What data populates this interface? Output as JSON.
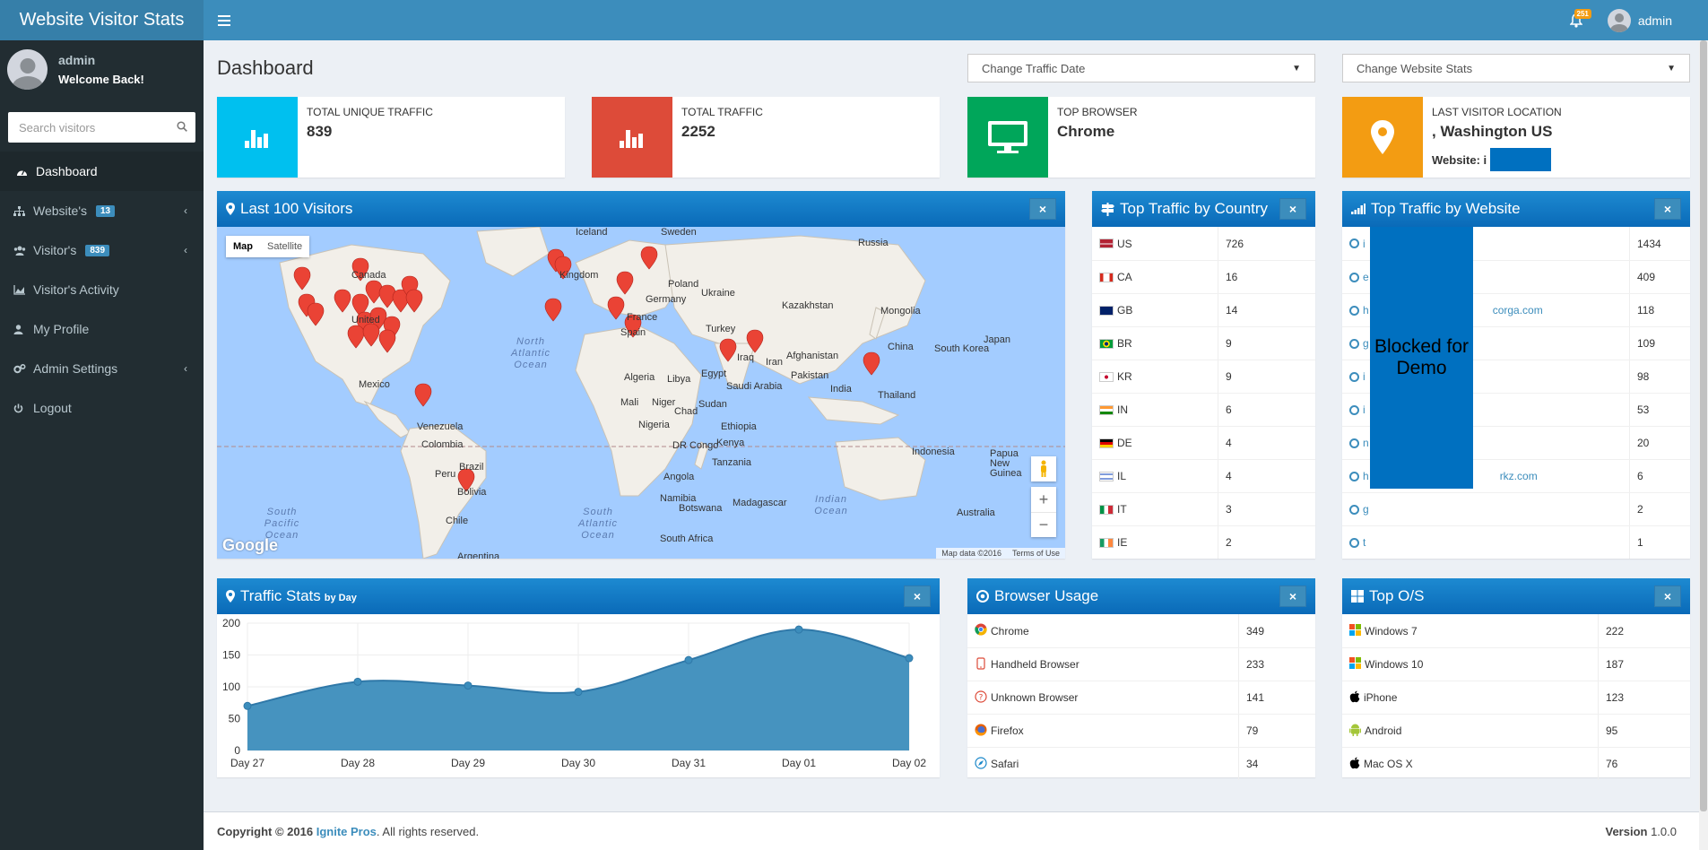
{
  "app": {
    "title": "Website Visitor Stats"
  },
  "topbar": {
    "notification_count": "251",
    "username": "admin"
  },
  "sidebar": {
    "user_name": "admin",
    "welcome": "Welcome Back!",
    "search_placeholder": "Search visitors",
    "items": [
      {
        "label": "Dashboard",
        "icon": "dashboard-icon",
        "active": true
      },
      {
        "label": "Website's",
        "icon": "sitemap-icon",
        "badge": "13"
      },
      {
        "label": "Visitor's",
        "icon": "users-icon",
        "badge": "839"
      },
      {
        "label": "Visitor's Activity",
        "icon": "area-chart-icon"
      },
      {
        "label": "My Profile",
        "icon": "user-icon"
      },
      {
        "label": "Admin Settings",
        "icon": "gears-icon"
      },
      {
        "label": "Logout",
        "icon": "power-icon"
      }
    ]
  },
  "page": {
    "title": "Dashboard",
    "traffic_date_select": "Change Traffic Date",
    "website_stats_select": "Change Website Stats"
  },
  "info_boxes": [
    {
      "label": "TOTAL UNIQUE TRAFFIC",
      "value": "839",
      "color": "#00c0ef",
      "icon": "bar-chart-icon"
    },
    {
      "label": "TOTAL TRAFFIC",
      "value": "2252",
      "color": "#dd4b39",
      "icon": "bar-chart-icon"
    },
    {
      "label": "TOP BROWSER",
      "value": "Chrome",
      "color": "#00a65a",
      "icon": "monitor-icon"
    },
    {
      "label": "LAST VISITOR LOCATION",
      "value": ", Washington US",
      "sub_label": "Website: i",
      "color": "#f39c12",
      "icon": "map-marker-icon"
    }
  ],
  "map_panel": {
    "title": "Last 100 Visitors",
    "btn_map": "Map",
    "btn_satellite": "Satellite",
    "map_data": "Map data ©2016",
    "terms": "Terms of Use",
    "google": "Google",
    "labels": [
      "Iceland",
      "Sweden",
      "Russia",
      "Canada",
      "United",
      "Kingdom",
      "Poland",
      "Ukraine",
      "Germany",
      "France",
      "Kazakhstan",
      "Mongolia",
      "Turkey",
      "Spain",
      "Iraq",
      "Iran",
      "Afghanistan",
      "China",
      "South Korea",
      "Japan",
      "Mexico",
      "Algeria",
      "Libya",
      "Egypt",
      "Saudi Arabia",
      "Pakistan",
      "India",
      "Thailand",
      "Mali",
      "Niger",
      "Chad",
      "Sudan",
      "Venezuela",
      "Nigeria",
      "Ethiopia",
      "Colombia",
      "DR Congo",
      "Kenya",
      "Indonesia",
      "Papua New Guinea",
      "Peru",
      "Tanzania",
      "Brazil",
      "Angola",
      "Bolivia",
      "Namibia",
      "Botswana",
      "Madagascar",
      "Australia",
      "Chile",
      "South Africa",
      "Argentina"
    ],
    "oceans": [
      "North Atlantic Ocean",
      "South Pacific Ocean",
      "South Atlantic Ocean",
      "Indian Ocean"
    ]
  },
  "country_panel": {
    "title": "Top Traffic by Country",
    "rows": [
      {
        "code": "US",
        "count": "726"
      },
      {
        "code": "CA",
        "count": "16"
      },
      {
        "code": "GB",
        "count": "14"
      },
      {
        "code": "BR",
        "count": "9"
      },
      {
        "code": "KR",
        "count": "9"
      },
      {
        "code": "IN",
        "count": "6"
      },
      {
        "code": "DE",
        "count": "4"
      },
      {
        "code": "IL",
        "count": "4"
      },
      {
        "code": "IT",
        "count": "3"
      },
      {
        "code": "IE",
        "count": "2"
      }
    ]
  },
  "website_panel": {
    "title": "Top Traffic by Website",
    "blocked_text": "Blocked for Demo",
    "rows": [
      {
        "name": "i",
        "count": "1434"
      },
      {
        "name": "e",
        "count": "409"
      },
      {
        "name": "h",
        "suffix": "corga.com",
        "count": "118"
      },
      {
        "name": "g",
        "count": "109"
      },
      {
        "name": "i",
        "count": "98"
      },
      {
        "name": "i",
        "count": "53"
      },
      {
        "name": "n",
        "count": "20"
      },
      {
        "name": "h",
        "suffix": "rkz.com",
        "count": "6"
      },
      {
        "name": "g",
        "count": "2"
      },
      {
        "name": "t",
        "count": "1"
      }
    ]
  },
  "traffic_panel": {
    "title": "Traffic Stats",
    "subtitle": "by Day"
  },
  "chart_data": {
    "type": "area",
    "categories": [
      "Day 27",
      "Day 28",
      "Day 29",
      "Day 30",
      "Day 31",
      "Day 01",
      "Day 02"
    ],
    "values": [
      70,
      108,
      102,
      92,
      142,
      190,
      145
    ],
    "ylim": [
      0,
      200
    ],
    "yticks": [
      "0",
      "50",
      "100",
      "150",
      "200"
    ],
    "color": "#3c8dbc",
    "grid": true
  },
  "browser_panel": {
    "title": "Browser Usage",
    "rows": [
      {
        "name": "Chrome",
        "count": "349",
        "icon": "chrome-icon"
      },
      {
        "name": "Handheld Browser",
        "count": "233",
        "icon": "handheld-icon"
      },
      {
        "name": "Unknown Browser",
        "count": "141",
        "icon": "question-icon"
      },
      {
        "name": "Firefox",
        "count": "79",
        "icon": "firefox-icon"
      },
      {
        "name": "Safari",
        "count": "34",
        "icon": "safari-icon"
      }
    ]
  },
  "os_panel": {
    "title": "Top O/S",
    "rows": [
      {
        "name": "Windows 7",
        "count": "222",
        "icon": "windows-icon"
      },
      {
        "name": "Windows 10",
        "count": "187",
        "icon": "windows-icon"
      },
      {
        "name": "iPhone",
        "count": "123",
        "icon": "apple-icon"
      },
      {
        "name": "Android",
        "count": "95",
        "icon": "android-icon"
      },
      {
        "name": "Mac OS X",
        "count": "76",
        "icon": "apple-icon"
      }
    ]
  },
  "footer": {
    "copyright": "Copyright © 2016",
    "company": "Ignite Pros",
    "rights": ". All rights reserved.",
    "version_label": "Version",
    "version": "1.0.0"
  }
}
